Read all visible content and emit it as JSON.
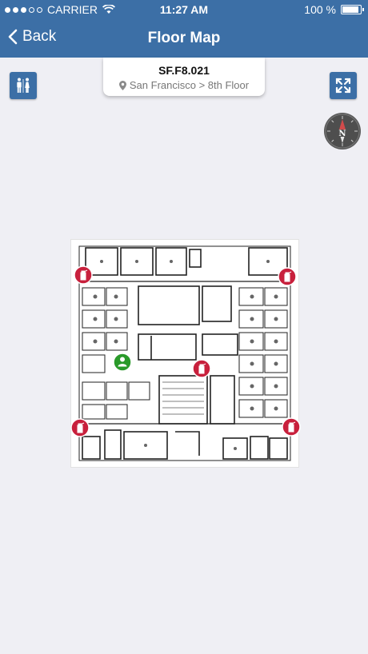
{
  "status_bar": {
    "carrier": "CARRIER",
    "time": "11:27 AM",
    "battery": "100 %",
    "battery_level": 1.0
  },
  "nav": {
    "back_label": "Back",
    "title": "Floor Map"
  },
  "location_card": {
    "room_code": "SF.F8.021",
    "location_path": "San Francisco > 8th Floor"
  },
  "buttons": {
    "restroom_icon": "restroom-icon",
    "expand_icon": "expand-icon"
  },
  "compass": {
    "direction_label": "N"
  },
  "map": {
    "current_location_icon": "person-location-icon",
    "marker_icon": "fire-extinguisher-icon",
    "colors": {
      "nav_bar": "#3c6fa6",
      "marker": "#c8203c",
      "current_location": "#2a9a2a"
    }
  }
}
